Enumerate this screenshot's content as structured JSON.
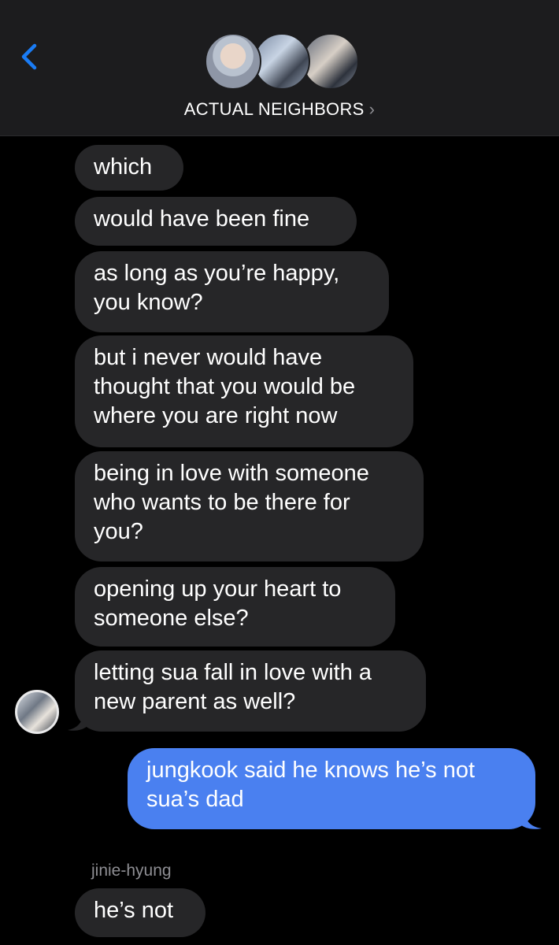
{
  "header": {
    "group_name": "ACTUAL NEIGHBORS",
    "chevron": "›",
    "back_icon": "chevron-left-icon",
    "accent": "#1a7cf5"
  },
  "messages": [
    {
      "dir": "in",
      "text": "which"
    },
    {
      "dir": "in",
      "text": "would have been fine"
    },
    {
      "dir": "in",
      "lines": [
        "as long as you’re happy,",
        "you know?"
      ]
    },
    {
      "dir": "in",
      "lines": [
        "but i never would have",
        "thought that you would be",
        "where you are right now"
      ]
    },
    {
      "dir": "in",
      "lines": [
        "being in love with someone",
        "who wants to be there for",
        "you?"
      ]
    },
    {
      "dir": "in",
      "lines": [
        "opening up your heart to",
        "someone else?"
      ]
    },
    {
      "dir": "in",
      "lines": [
        "letting sua fall in love with a",
        "new parent as well?"
      ]
    },
    {
      "dir": "out",
      "lines": [
        "jungkook said he knows he’s not",
        "sua’s dad"
      ]
    },
    {
      "dir": "in",
      "sender": "jinie-hyung",
      "text": "he’s not"
    }
  ],
  "colors": {
    "background": "#000000",
    "header_bg": "#1c1c1e",
    "incoming_bubble": "#262628",
    "outgoing_bubble": "#4a80f0",
    "sender_label": "#8e8e93"
  }
}
